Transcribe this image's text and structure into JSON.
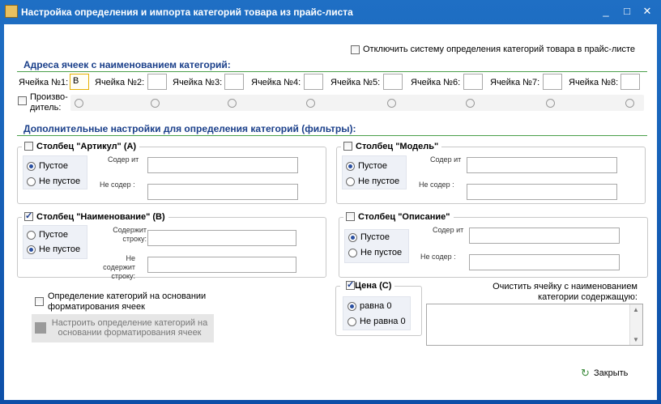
{
  "window": {
    "title": "Настройка определения и импорта категорий товара из прайс-листа",
    "min_icon": "_",
    "max_icon": "□",
    "close_icon": "✕"
  },
  "disable_system": {
    "label": "Отключить систему определения категорий товара в прайс-листе",
    "checked": false
  },
  "addresses": {
    "title": "Адреса ячеек с наименованием категорий:",
    "cells": [
      {
        "label": "Ячейка №1:",
        "value": "B"
      },
      {
        "label": "Ячейка №2:",
        "value": ""
      },
      {
        "label": "Ячейка №3:",
        "value": ""
      },
      {
        "label": "Ячейка №4:",
        "value": ""
      },
      {
        "label": "Ячейка №5:",
        "value": ""
      },
      {
        "label": "Ячейка №6:",
        "value": ""
      },
      {
        "label": "Ячейка №7:",
        "value": ""
      },
      {
        "label": "Ячейка №8:",
        "value": ""
      }
    ],
    "manufacturer_label_1": "Произво-",
    "manufacturer_label_2": "дитель:"
  },
  "filters": {
    "title": "Дополнительные настройки для определения категорий (фильтры):",
    "article": {
      "title": "Столбец \"Артикул\" (А)",
      "checked": false,
      "empty": "Пустое",
      "not_empty": "Не пустое",
      "selected": "empty",
      "contains": "Содер ит",
      "not_contains": "Не содер  :"
    },
    "model": {
      "title": "Столбец \"Модель\"",
      "checked": false,
      "empty": "Пустое",
      "not_empty": "Не пустое",
      "selected": "empty",
      "contains": "Содер ит",
      "not_contains": "Не содер  :"
    },
    "name": {
      "title": "Столбец \"Наименование\" (В)",
      "checked": true,
      "empty": "Пустое",
      "not_empty": "Не пустое",
      "selected": "not_empty",
      "contains_1": "Содержит",
      "contains_2": "строку:",
      "not_contains_1": "Не",
      "not_contains_2": "содержит",
      "not_contains_3": "строку:"
    },
    "description": {
      "title": "Столбец \"Описание\"",
      "checked": false,
      "empty": "Пустое",
      "not_empty": "Не пустое",
      "selected": "empty",
      "contains": "Содер ит",
      "not_contains": "Не содер  :"
    },
    "price": {
      "title": "Цена (С)",
      "checked": true,
      "zero": "равна 0",
      "not_zero": "Не равна 0",
      "selected": "zero"
    }
  },
  "formatting": {
    "label_1": "Определение категорий на основании",
    "label_2": "форматирования ячеек",
    "checked": false,
    "button_1": "Настроить определение категорий на",
    "button_2": "основании форматирования ячеек"
  },
  "clear_cell": {
    "label_1": "Очистить ячейку с наименованием",
    "label_2": "категории содержащую:",
    "value": ""
  },
  "close_button": {
    "label": "Закрыть"
  }
}
